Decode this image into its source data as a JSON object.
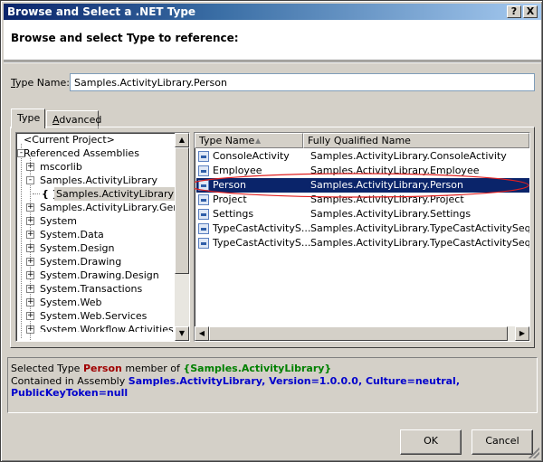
{
  "window": {
    "title": "Browse and Select a .NET Type",
    "help_button": "?",
    "close_button": "X"
  },
  "header": {
    "text": "Browse and select Type to reference:"
  },
  "type_name": {
    "label": "Type Name:",
    "value": "Samples.ActivityLibrary.Person"
  },
  "tabs": [
    {
      "label": "Type",
      "active": true
    },
    {
      "label": "Advanced",
      "active": false
    }
  ],
  "tree": {
    "items": [
      {
        "label": "<Current Project>",
        "expander": ""
      },
      {
        "label": "Referenced Assemblies",
        "expander": "-"
      },
      {
        "label": "mscorlib",
        "expander": "+"
      },
      {
        "label": "Samples.ActivityLibrary",
        "expander": "-"
      },
      {
        "label": "Samples.ActivityLibrary",
        "icon": "{ }",
        "selected": true
      },
      {
        "label": "Samples.ActivityLibrary.Generic",
        "expander": "+"
      },
      {
        "label": "System",
        "expander": "+"
      },
      {
        "label": "System.Data",
        "expander": "+"
      },
      {
        "label": "System.Design",
        "expander": "+"
      },
      {
        "label": "System.Drawing",
        "expander": "+"
      },
      {
        "label": "System.Drawing.Design",
        "expander": "+"
      },
      {
        "label": "System.Transactions",
        "expander": "+"
      },
      {
        "label": "System.Web",
        "expander": "+"
      },
      {
        "label": "System.Web.Services",
        "expander": "+"
      },
      {
        "label": "System.Workflow.Activities",
        "expander": "+"
      }
    ]
  },
  "types_list": {
    "columns": [
      "Type Name",
      "Fully Qualified Name"
    ],
    "sort_indicator": "▲",
    "rows": [
      {
        "name": "ConsoleActivity",
        "qualified": "Samples.ActivityLibrary.ConsoleActivity"
      },
      {
        "name": "Employee",
        "qualified": "Samples.ActivityLibrary.Employee"
      },
      {
        "name": "Person",
        "qualified": "Samples.ActivityLibrary.Person",
        "selected": true
      },
      {
        "name": "Project",
        "qualified": "Samples.ActivityLibrary.Project"
      },
      {
        "name": "Settings",
        "qualified": "Samples.ActivityLibrary.Settings"
      },
      {
        "name": "TypeCastActivityS...",
        "qualified": "Samples.ActivityLibrary.TypeCastActivitySequence"
      },
      {
        "name": "TypeCastActivityS...",
        "qualified": "Samples.ActivityLibrary.TypeCastActivitySequenceDe"
      }
    ]
  },
  "info": {
    "line1_prefix": "Selected Type",
    "selected_type": "Person",
    "line1_middle": "member of",
    "member_of": "{Samples.ActivityLibrary}",
    "line2_prefix": "Contained in Assembly",
    "assembly": "Samples.ActivityLibrary, Version=1.0.0.0, Culture=neutral, PublicKeyToken=null"
  },
  "buttons": {
    "ok": "OK",
    "cancel": "Cancel"
  },
  "colors": {
    "selection": "#0a246a",
    "annotation": "#e02020",
    "type_name_red": "#a00000",
    "namespace_green": "#008000",
    "assembly_blue": "#0000cc"
  }
}
